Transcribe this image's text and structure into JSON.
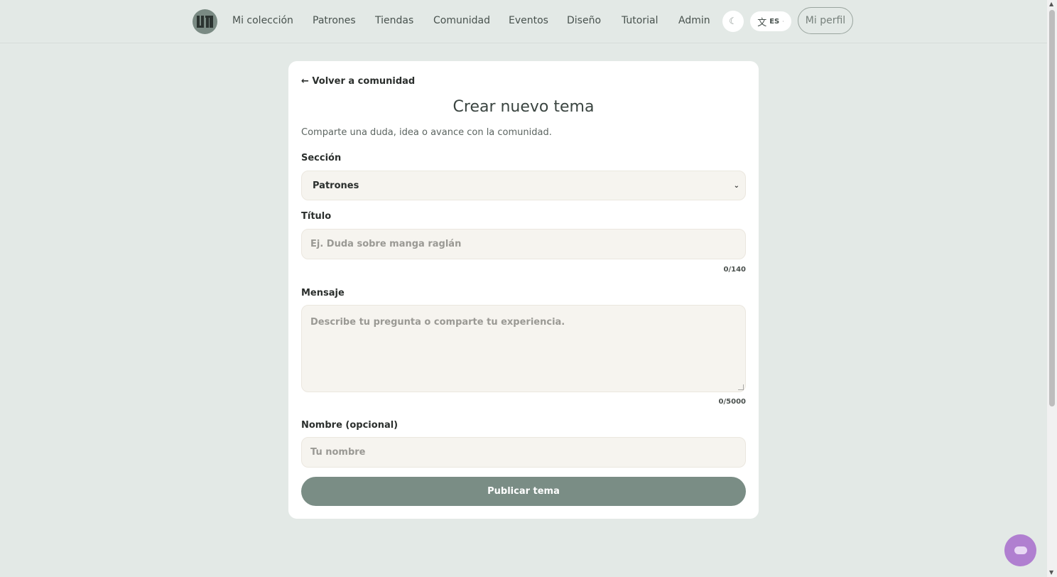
{
  "nav": {
    "logo_text": "U1",
    "links": [
      "Mi colección",
      "Patrones",
      "Tiendas",
      "Comunidad",
      "Eventos",
      "Diseño",
      "Tutorial",
      "Admin"
    ],
    "theme_icon": "☾",
    "lang_icon": "文",
    "lang_code": "ES",
    "lang_caret": "·",
    "profile": "Mi perfil"
  },
  "form": {
    "back": "← Volver a comunidad",
    "title": "Crear nuevo tema",
    "subtitle": "Comparte una duda, idea o avance con la comunidad.",
    "section_label": "Sección",
    "section_value": "Patrones",
    "title_label": "Título",
    "title_placeholder": "Ej. Duda sobre manga raglán",
    "title_counter": "0/140",
    "message_label": "Mensaje",
    "message_placeholder": "Describe tu pregunta o comparte tu experiencia.",
    "message_counter": "0/5000",
    "name_label": "Nombre (opcional)",
    "name_placeholder": "Tu nombre",
    "submit": "Publicar tema"
  },
  "colors": {
    "background": "#e3e9e6",
    "accent": "#7a8d85",
    "chat": "#b07fd0"
  }
}
